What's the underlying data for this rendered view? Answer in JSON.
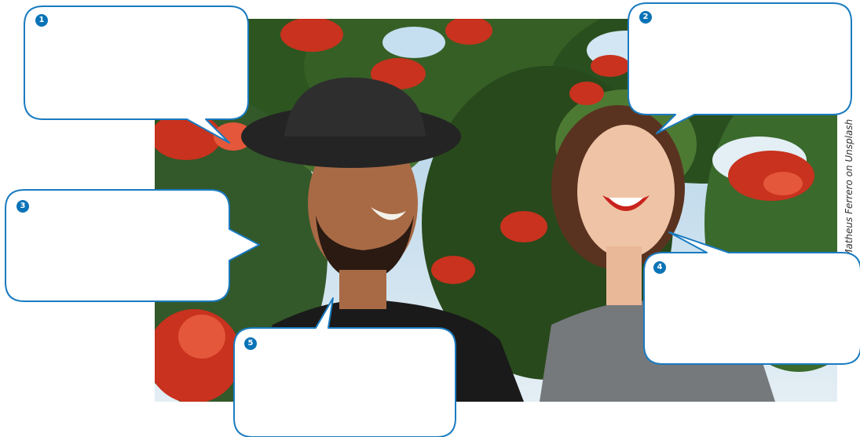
{
  "photo": {
    "credit": "Matheus Ferrero on Unsplash"
  },
  "bubbles": [
    {
      "number": "1"
    },
    {
      "number": "2"
    },
    {
      "number": "3"
    },
    {
      "number": "4"
    },
    {
      "number": "5"
    }
  ],
  "colors": {
    "bubble_border": "#1a7bc0",
    "badge": "#0a73b7",
    "foliage": "#2f5a22",
    "flowers": "#c8321e",
    "sky": "#bcd9ee"
  }
}
